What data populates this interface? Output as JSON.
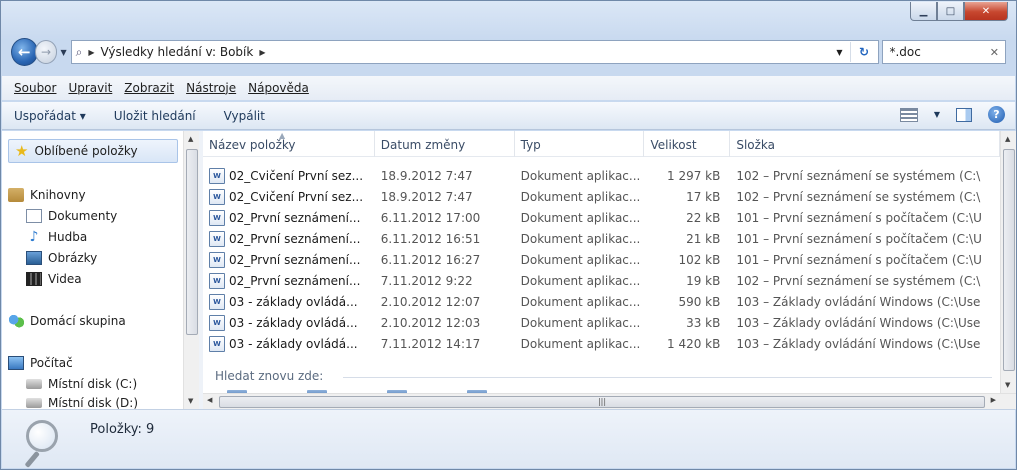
{
  "address": {
    "path_label": "Výsledky hledání v: Bobík",
    "search_value": "*.doc"
  },
  "menu": {
    "items": [
      "Soubor",
      "Upravit",
      "Zobrazit",
      "Nástroje",
      "Nápověda"
    ]
  },
  "toolbar": {
    "organize": "Uspořádat ▾",
    "save_search": "Uložit hledání",
    "burn": "Vypálit"
  },
  "nav": {
    "favorites": "Oblíbené položky",
    "libraries": "Knihovny",
    "lib_docs": "Dokumenty",
    "lib_music": "Hudba",
    "lib_pictures": "Obrázky",
    "lib_videos": "Videa",
    "homegroup": "Domácí skupina",
    "computer": "Počítač",
    "disk_c": "Místní disk (C:)",
    "disk_d": "Místní disk (D:)"
  },
  "columns": [
    "Název položky",
    "Datum změny",
    "Typ",
    "Velikost",
    "Složka"
  ],
  "files": [
    {
      "name": "02_Cvičení První sez...",
      "date": "18.9.2012 7:47",
      "type": "Dokument aplikac...",
      "size": "1 297 kB",
      "folder": "102 – První seznámení se systémem (C:\\"
    },
    {
      "name": "02_Cvičení První sez...",
      "date": "18.9.2012 7:47",
      "type": "Dokument aplikac...",
      "size": "17 kB",
      "folder": "102 – První seznámení se systémem (C:\\"
    },
    {
      "name": "02_První seznámení...",
      "date": "6.11.2012 17:00",
      "type": "Dokument aplikac...",
      "size": "22 kB",
      "folder": "101 – První seznámení s počítačem (C:\\U"
    },
    {
      "name": "02_První seznámení...",
      "date": "6.11.2012 16:51",
      "type": "Dokument aplikac...",
      "size": "21 kB",
      "folder": "101 – První seznámení s počítačem (C:\\U"
    },
    {
      "name": "02_První seznámení...",
      "date": "6.11.2012 16:27",
      "type": "Dokument aplikac...",
      "size": "102 kB",
      "folder": "101 – První seznámení s počítačem (C:\\U"
    },
    {
      "name": "02_První seznámení...",
      "date": "7.11.2012 9:22",
      "type": "Dokument aplikac...",
      "size": "19 kB",
      "folder": "102 – První seznámení se systémem (C:\\"
    },
    {
      "name": "03 - základy ovládá...",
      "date": "2.10.2012 12:07",
      "type": "Dokument aplikac...",
      "size": "590 kB",
      "folder": "103 – Základy ovládání Windows (C:\\Use"
    },
    {
      "name": "03 - základy ovládá...",
      "date": "2.10.2012 12:03",
      "type": "Dokument aplikac...",
      "size": "33 kB",
      "folder": "103 – Základy ovládání Windows (C:\\Use"
    },
    {
      "name": "03 - základy ovládá...",
      "date": "7.11.2012 14:17",
      "type": "Dokument aplikac...",
      "size": "1 420 kB",
      "folder": "103 – Základy ovládání Windows (C:\\Use"
    }
  ],
  "search_again_label": "Hledat znovu zde:",
  "status": {
    "item_count": "Položky: 9"
  }
}
